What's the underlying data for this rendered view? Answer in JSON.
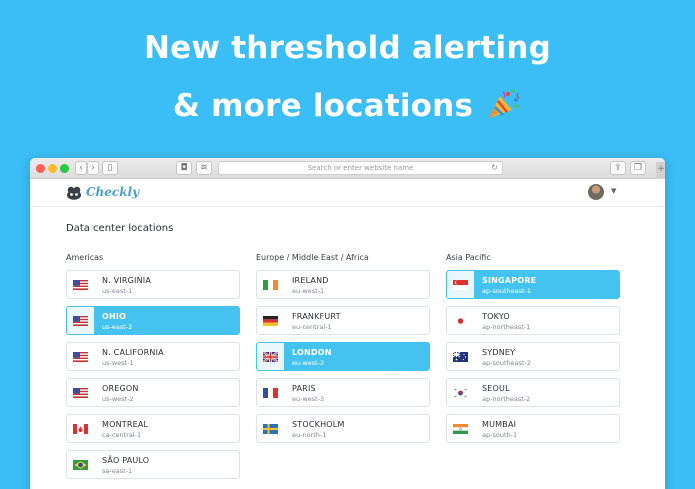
{
  "headline": {
    "line1": "New threshold alerting",
    "line2": "& more locations"
  },
  "browser": {
    "address_placeholder": "Search or enter website name",
    "new_tab_label": "+"
  },
  "app": {
    "logo_text": "Checkly",
    "accent_color": "#45c3f0"
  },
  "page": {
    "title": "Data center locations",
    "columns": [
      {
        "title": "Americas",
        "items": [
          {
            "name": "N. VIRGINIA",
            "code": "us-east-1",
            "flag": "us-flag-icon",
            "selected": false
          },
          {
            "name": "OHIO",
            "code": "us-east-2",
            "flag": "us-flag-icon",
            "selected": true
          },
          {
            "name": "N. CALIFORNIA",
            "code": "us-west-1",
            "flag": "us-flag-icon",
            "selected": false
          },
          {
            "name": "OREGON",
            "code": "us-west-2",
            "flag": "us-flag-icon",
            "selected": false
          },
          {
            "name": "MONTREAL",
            "code": "ca-central-1",
            "flag": "canada-flag-icon",
            "selected": false
          },
          {
            "name": "SÃO PAULO",
            "code": "sa-east-1",
            "flag": "brazil-flag-icon",
            "selected": false
          }
        ]
      },
      {
        "title": "Europe / Middle East / Africa",
        "items": [
          {
            "name": "IRELAND",
            "code": "eu-west-1",
            "flag": "ireland-flag-icon",
            "selected": false
          },
          {
            "name": "FRANKFURT",
            "code": "eu-central-1",
            "flag": "germany-flag-icon",
            "selected": false
          },
          {
            "name": "LONDON",
            "code": "eu-west-2",
            "flag": "uk-flag-icon",
            "selected": true
          },
          {
            "name": "PARIS",
            "code": "eu-west-3",
            "flag": "france-flag-icon",
            "selected": false
          },
          {
            "name": "STOCKHOLM",
            "code": "eu-north-1",
            "flag": "sweden-flag-icon",
            "selected": false
          }
        ]
      },
      {
        "title": "Asia Pacific",
        "items": [
          {
            "name": "SINGAPORE",
            "code": "ap-southeast-1",
            "flag": "singapore-flag-icon",
            "selected": true
          },
          {
            "name": "TOKYO",
            "code": "ap-northeast-1",
            "flag": "japan-flag-icon",
            "selected": false
          },
          {
            "name": "SYDNEY",
            "code": "ap-southeast-2",
            "flag": "australia-flag-icon",
            "selected": false
          },
          {
            "name": "SEOUL",
            "code": "ap-northeast-2",
            "flag": "korea-flag-icon",
            "selected": false
          },
          {
            "name": "MUMBAI",
            "code": "ap-south-1",
            "flag": "india-flag-icon",
            "selected": false
          }
        ]
      }
    ]
  }
}
